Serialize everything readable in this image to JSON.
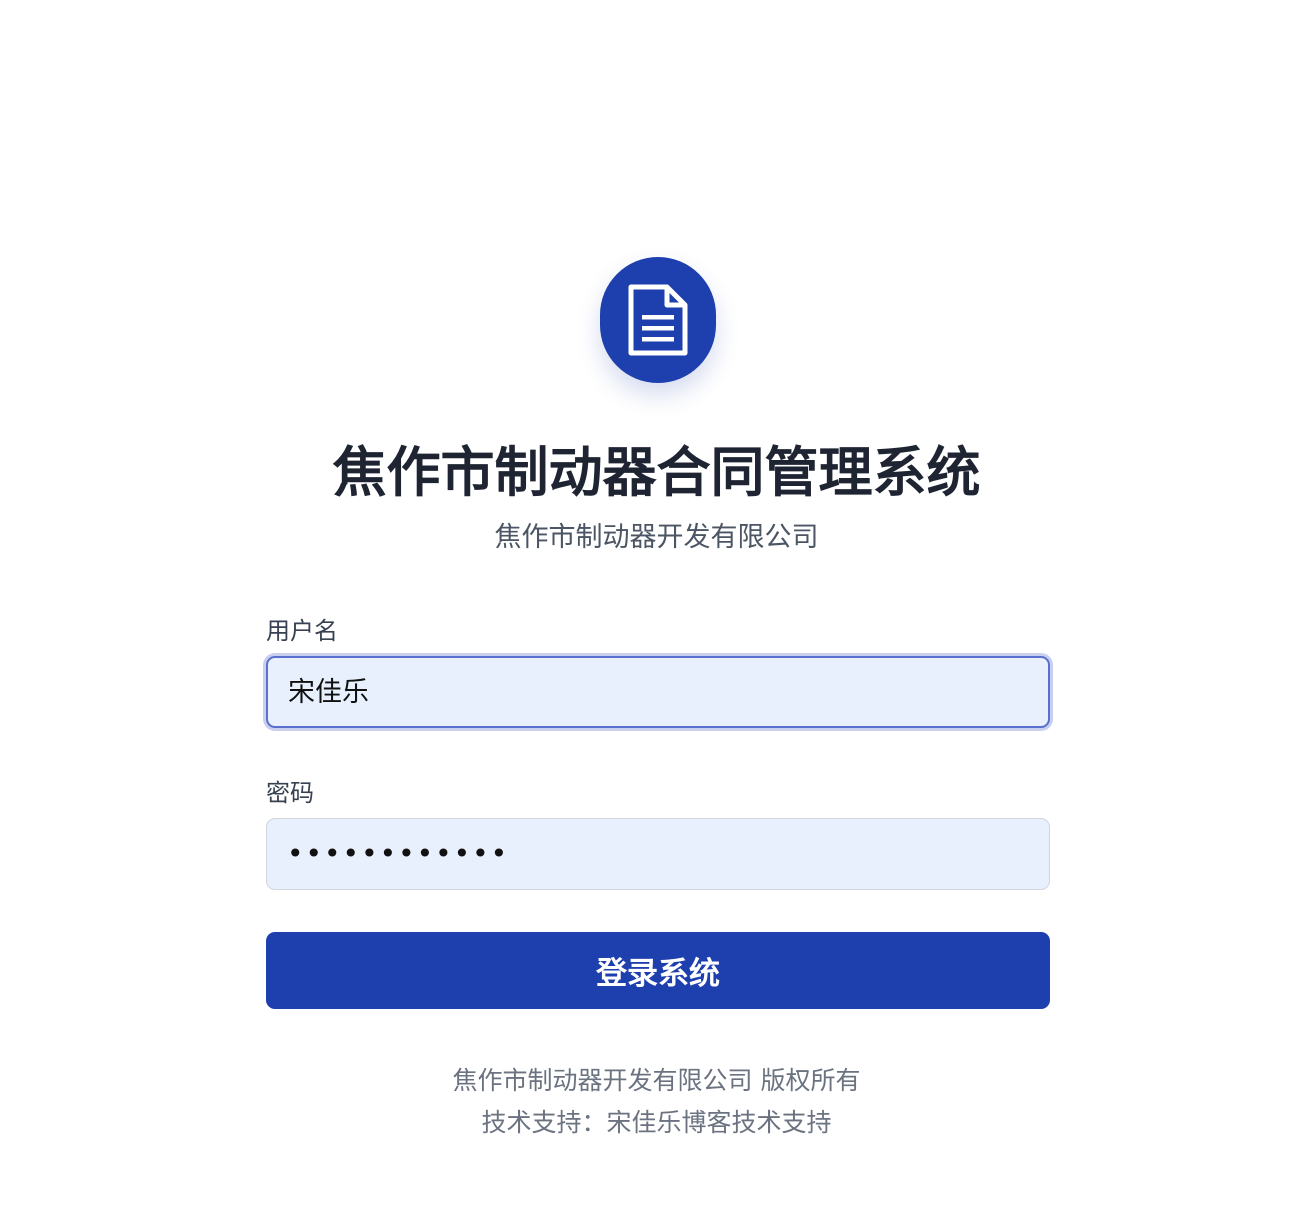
{
  "logo": {
    "icon": "document-icon",
    "color": "#1e3fae"
  },
  "header": {
    "title": "焦作市制动器合同管理系统",
    "subtitle": "焦作市制动器开发有限公司"
  },
  "form": {
    "username": {
      "label": "用户名",
      "value": "宋佳乐"
    },
    "password": {
      "label": "密码",
      "value": "••••••••••••"
    },
    "submit_label": "登录系统"
  },
  "footer": {
    "copyright": "焦作市制动器开发有限公司 版权所有",
    "support": "技术支持：宋佳乐博客技术支持"
  },
  "colors": {
    "primary": "#1e3fae",
    "input_bg": "#e8f0fe",
    "title_text": "#1f2432",
    "muted_text": "#6b7280"
  }
}
